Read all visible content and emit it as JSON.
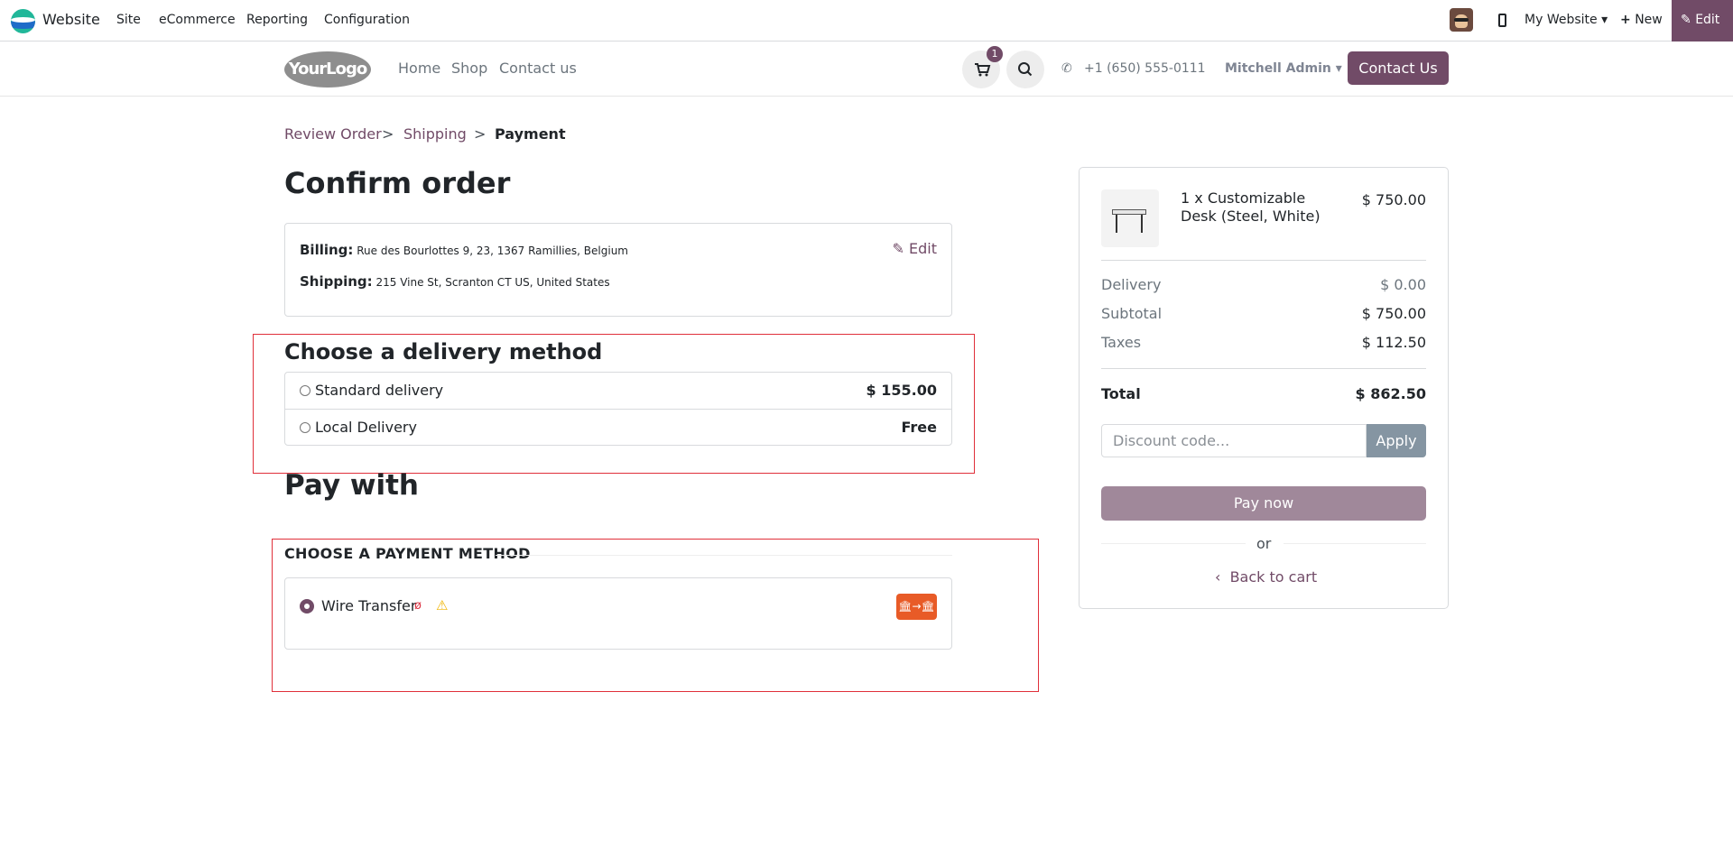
{
  "admin_nav": {
    "app_name": "Website",
    "menu": [
      "Site",
      "eCommerce",
      "Reporting",
      "Configuration"
    ],
    "website_selector": "My Website",
    "new_label": "New",
    "edit_label": "Edit"
  },
  "site_header": {
    "logo_text": "YourLogo",
    "links": [
      "Home",
      "Shop",
      "Contact us"
    ],
    "cart_count": "1",
    "phone": "+1 (650) 555-0111",
    "user": "Mitchell Admin",
    "contact_button": "Contact Us"
  },
  "breadcrumb": {
    "steps": [
      "Review Order",
      "Shipping",
      "Payment"
    ],
    "separator": ">"
  },
  "page_title": "Confirm order",
  "addresses": {
    "billing_label": "Billing:",
    "billing_value": "Rue des Bourlottes 9, 23, 1367 Ramillies, Belgium",
    "shipping_label": "Shipping:",
    "shipping_value": "215 Vine St, Scranton CT US, United States",
    "edit_label": "Edit"
  },
  "delivery": {
    "title": "Choose a delivery method",
    "methods": [
      {
        "label": "Standard delivery",
        "price": "$ 155.00"
      },
      {
        "label": "Local Delivery",
        "price": "Free"
      }
    ]
  },
  "payment": {
    "title": "Pay with",
    "heading": "CHOOSE A PAYMENT METHOD",
    "method": "Wire Transfer",
    "icons": [
      "eye-slash-icon",
      "warning-icon",
      "bank-transfer-icon"
    ]
  },
  "summary": {
    "item_name": "1 x Customizable Desk (Steel, White)",
    "item_price": "$ 750.00",
    "rows": [
      {
        "label": "Delivery",
        "value": "$ 0.00"
      },
      {
        "label": "Subtotal",
        "value": "$ 750.00"
      },
      {
        "label": "Taxes",
        "value": "$ 112.50"
      }
    ],
    "total_label": "Total",
    "total_value": "$ 862.50",
    "discount_placeholder": "Discount code...",
    "apply_label": "Apply",
    "pay_label": "Pay now",
    "or_label": "or",
    "back_label": "Back to cart"
  },
  "colors": {
    "brand": "#714b67",
    "highlight_border": "#e0303a",
    "bank_badge": "#e85b27"
  }
}
